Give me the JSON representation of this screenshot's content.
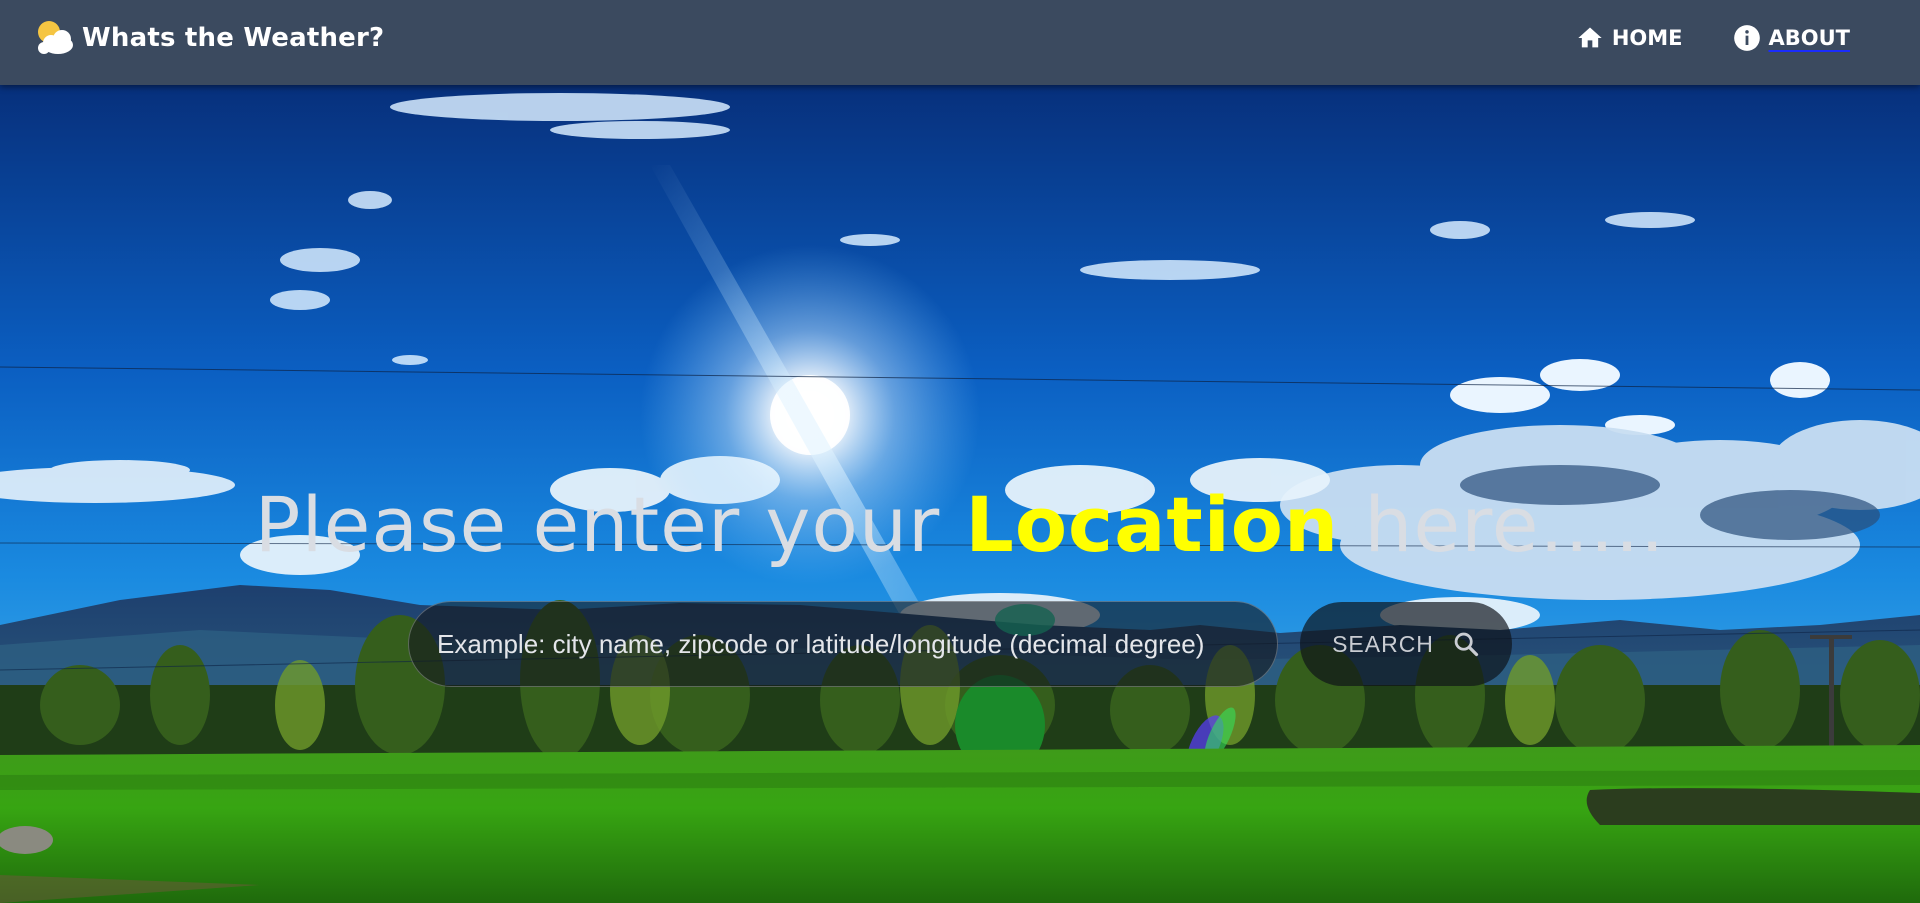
{
  "app": {
    "title": "Whats the Weather?",
    "logo_icon": "sun-cloud-icon"
  },
  "nav": {
    "items": [
      {
        "label": "HOME",
        "icon": "home-icon"
      },
      {
        "label": "ABOUT",
        "icon": "info-icon"
      }
    ]
  },
  "hero": {
    "headline_prefix": "Please enter your ",
    "headline_highlight": "Location",
    "headline_suffix": " here.....",
    "search": {
      "placeholder": "Example: city name, zipcode or latitude/longitude (decimal degree)",
      "value": "",
      "button_label": "SEARCH",
      "button_icon": "search-icon"
    }
  },
  "colors": {
    "navbar": "#3b4a5f",
    "highlight": "#ffff00",
    "headline": "#d9dde3",
    "link_underline": "#1a2cff"
  }
}
